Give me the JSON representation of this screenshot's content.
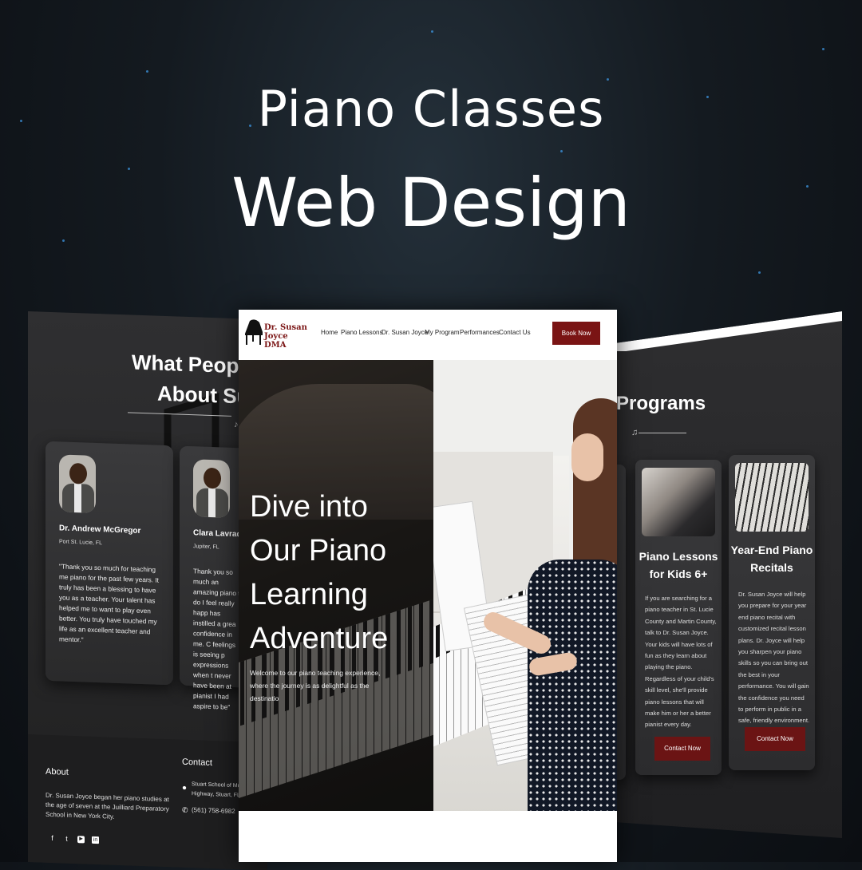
{
  "headline": {
    "line1": "Piano Classes",
    "line2": "Web Design"
  },
  "colors": {
    "brand": "#7a1414",
    "button": "#6b1414",
    "background": "#141a20"
  },
  "left_page": {
    "title_line1": "What People",
    "title_line2": "About Sus",
    "note_icon": "music-note-icon",
    "testimonials": [
      {
        "name": "Dr. Andrew McGregor",
        "location": "Port St. Lucie, FL",
        "quote": "\"Thank you so much for teaching me piano for the past few years. It truly has been a blessing to have you as a teacher. Your talent has helped me to want to play even better. You truly have touched my life as an excellent teacher and mentor.\""
      },
      {
        "name": "Clara Lavrador",
        "location": "Jupiter, FL",
        "quote": "Thank you so much an amazing piano t do I feel really happ has instilled a grea confidence in me. C feelings is seeing p expressions when t never have been at pianist I had aspire to be\""
      }
    ],
    "footer": {
      "about_title": "About",
      "about_text": "Dr. Susan Joyce began her piano studies at the age of seven at the Juilliard Preparatory School in New York City.",
      "contact_title": "Contact",
      "address": "Stuart School of Musi Highway, Stuart, FL 3",
      "phone": "(561) 758-6982",
      "social_icons": [
        "facebook-icon",
        "twitter-icon",
        "youtube-icon",
        "linkedin-icon"
      ]
    }
  },
  "center_page": {
    "logo": {
      "line1": "Dr. Susan Joyce",
      "line2": "DMA"
    },
    "nav": [
      "Home",
      "Piano Lessons",
      "Dr. Susan Joyce",
      "My Program",
      "Performances",
      "Contact Us"
    ],
    "book_button": "Book Now",
    "hero_title": "Dive into Our Piano Learning Adventure",
    "hero_subtitle": "Welcome to our piano teaching experience, where the journey is as delightful as the destinatio"
  },
  "right_page": {
    "title": "Programs",
    "programs": [
      {
        "title": "Piano Lessons for Kids 6+",
        "text": "If you are searching for a piano teacher in St. Lucie County and Martin County, talk to Dr. Susan Joyce. Your kids will have lots of fun as they learn about playing the piano. Regardless of your child's skill level, she'll provide piano lessons that will make him or her a better pianist every day.",
        "button": "Contact Now"
      },
      {
        "title": "Year-End Piano Recitals",
        "text": "Dr. Susan Joyce will help you prepare for your year end piano recital with customized recital lesson plans. Dr. Joyce will help you sharpen your piano skills so you can bring out the best in your performance. You will gain the confidence you need to perform in public in a safe, friendly environment.",
        "button": "Contact Now"
      }
    ]
  }
}
